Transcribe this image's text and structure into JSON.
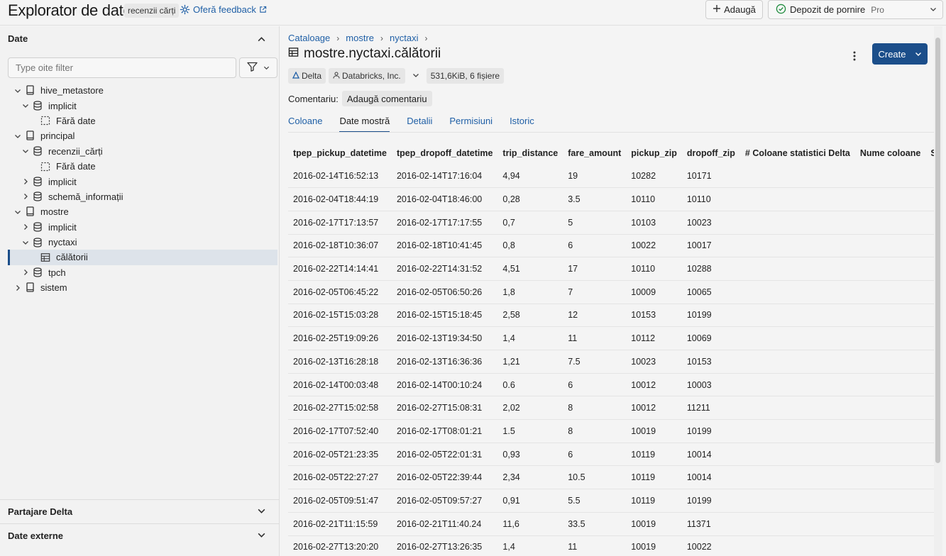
{
  "topbar": {
    "title": "Explorator de date",
    "catalog_chip": "recenzii cărți",
    "feedback": "Oferă feedback",
    "add_label": "Adaugă",
    "warehouse_name": "Depozit de pornire",
    "warehouse_tier": "Pro"
  },
  "sidebar": {
    "heading": "Date",
    "filter_placeholder": "Type oite filter",
    "tree": [
      {
        "label": "hive_metastore",
        "level": 0,
        "caret": "down",
        "icon": "catalog-icon"
      },
      {
        "label": "implicit",
        "level": 1,
        "caret": "down",
        "icon": "database-icon"
      },
      {
        "label": "Fără date",
        "level": 2,
        "caret": "none",
        "icon": "empty-icon"
      },
      {
        "label": "principal",
        "level": 0,
        "caret": "down",
        "icon": "catalog-icon"
      },
      {
        "label": "recenzii_cărți",
        "level": 1,
        "caret": "down",
        "icon": "database-icon"
      },
      {
        "label": "Fără date",
        "level": 2,
        "caret": "none",
        "icon": "empty-icon"
      },
      {
        "label": "implicit",
        "level": 1,
        "caret": "right",
        "icon": "database-icon"
      },
      {
        "label": "schemă_informații",
        "level": 1,
        "caret": "right",
        "icon": "database-icon"
      },
      {
        "label": "mostre",
        "level": 0,
        "caret": "down",
        "icon": "catalog-icon"
      },
      {
        "label": "implicit",
        "level": 1,
        "caret": "right",
        "icon": "database-icon"
      },
      {
        "label": "nyctaxi",
        "level": 1,
        "caret": "down",
        "icon": "database-icon"
      },
      {
        "label": "călătorii",
        "level": 2,
        "caret": "none",
        "icon": "table-icon",
        "selected": true
      },
      {
        "label": "tpch",
        "level": 1,
        "caret": "right",
        "icon": "database-icon"
      },
      {
        "label": "sistem",
        "level": 0,
        "caret": "right",
        "icon": "catalog-icon"
      }
    ],
    "section_delta": "Partajare Delta",
    "section_external": "Date externe"
  },
  "main": {
    "breadcrumbs": [
      "Cataloage",
      "mostre",
      "nyctaxi"
    ],
    "table_title": "mostre.nyctaxi.călătorii",
    "create_label": "Create",
    "tag_delta": "Delta",
    "tag_owner": "Databricks, Inc.",
    "tag_size": "531,6KiB, 6 fișiere",
    "comment_label": "Comentariu:",
    "comment_button": "Adaugă comentariu",
    "tabs": [
      "Coloane",
      "Date mostră",
      "Detalii",
      "Permisiuni",
      "Istoric"
    ],
    "active_tab": 1,
    "columns": [
      "tpep_pickup_datetime",
      "tpep_dropoff_datetime",
      "trip_distance",
      "fare_amount",
      "pickup_zip",
      "dropoff_zip",
      "# Coloane statistici Delta",
      "Nume coloane",
      "Selecție coloane"
    ],
    "rows": [
      [
        "2016-02-14T16:52:13",
        "2016-02-14T17:16:04",
        "4,94",
        "19",
        "10282",
        "10171"
      ],
      [
        "2016-02-04T18:44:19",
        "2016-02-04T18:46:00",
        "0,28",
        "3.5",
        "10110",
        "10110"
      ],
      [
        "2016-02-17T17:13:57",
        "2016-02-17T17:17:55",
        "0,7",
        "5",
        "10103",
        "10023"
      ],
      [
        "2016-02-18T10:36:07",
        "2016-02-18T10:41:45",
        "0,8",
        "6",
        "10022",
        "10017"
      ],
      [
        "2016-02-22T14:14:41",
        "2016-02-22T14:31:52",
        "4,51",
        "17",
        "10110",
        "10288"
      ],
      [
        "2016-02-05T06:45:22",
        "2016-02-05T06:50:26",
        "1,8",
        "7",
        "10009",
        "10065"
      ],
      [
        "2016-02-15T15:03:28",
        "2016-02-15T15:18:45",
        "2,58",
        "12",
        "10153",
        "10199"
      ],
      [
        "2016-02-25T19:09:26",
        "2016-02-13T19:34:50",
        "1,4",
        "11",
        "10112",
        "10069"
      ],
      [
        "2016-02-13T16:28:18",
        "2016-02-13T16:36:36",
        "1,21",
        "7.5",
        "10023",
        "10153"
      ],
      [
        "2016-02-14T00:03:48",
        "2016-02-14T00:10:24",
        "0.6",
        "6",
        "10012",
        "10003"
      ],
      [
        "2016-02-27T15:02:58",
        "2016-02-27T15:08:31",
        "2,02",
        "8",
        "10012",
        "11211"
      ],
      [
        "2016-02-17T07:52:40",
        "2016-02-17T08:01:21",
        "1.5",
        "8",
        "10019",
        "10199"
      ],
      [
        "2016-02-05T21:23:35",
        "2016-02-05T22:01:31",
        "0,93",
        "6",
        "10119",
        "10014"
      ],
      [
        "2016-02-05T22:27:27",
        "2016-02-05T22:39:44",
        "2,34",
        "10.5",
        "10119",
        "10014"
      ],
      [
        "2016-02-05T09:51:47",
        "2016-02-05T09:57:27",
        "0,91",
        "5.5",
        "10119",
        "10199"
      ],
      [
        "2016-02-21T11:15:59",
        "2016-02-21T11:40.24",
        "11,6",
        "33.5",
        "10019",
        "11371"
      ],
      [
        "2016-02-27T13:20:20",
        "2016-02-27T13:26:35",
        "1,4",
        "11",
        "10019",
        "10022"
      ]
    ]
  }
}
